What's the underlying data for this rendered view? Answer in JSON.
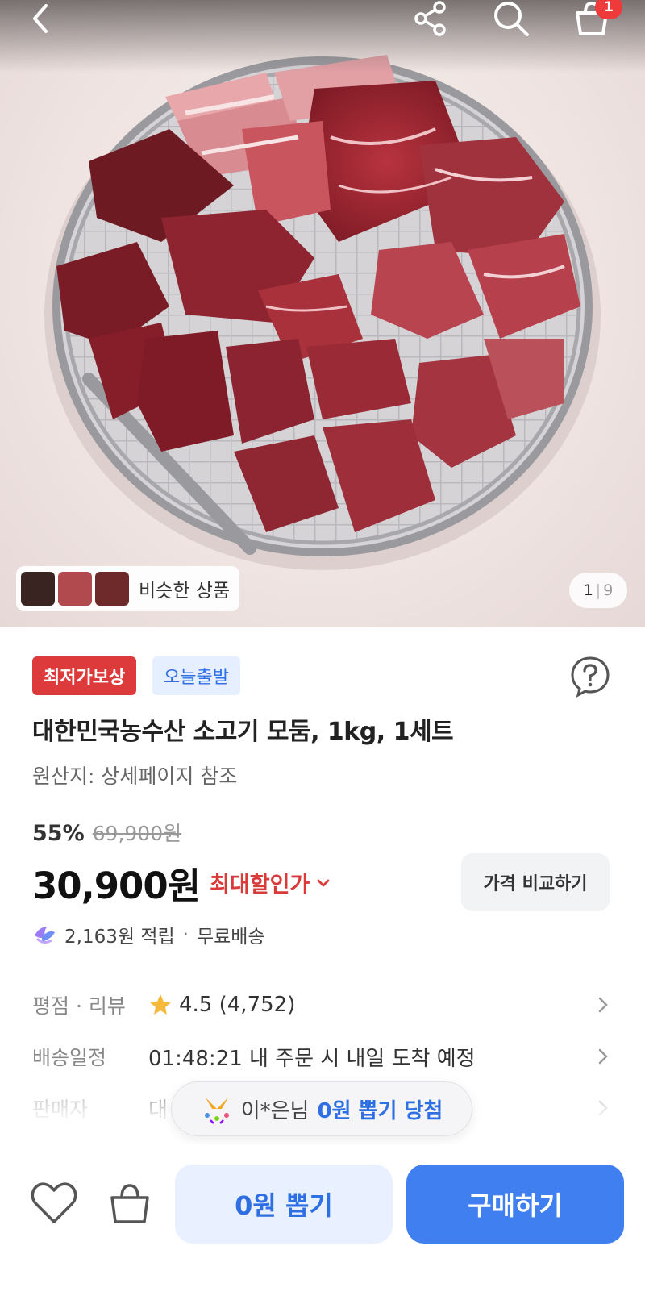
{
  "header": {
    "back_icon": "chevron-left-icon",
    "share_icon": "share-icon",
    "search_icon": "search-icon",
    "cart_icon": "cart-icon",
    "cart_badge": "1"
  },
  "gallery": {
    "similar_label": "비슷한 상품",
    "current": "1",
    "separator": "|",
    "total": "9"
  },
  "badges": {
    "lowest_price": "최저가보상",
    "today_ship": "오늘출발"
  },
  "product": {
    "title": "대한민국농수산 소고기 모둠, 1kg, 1세트",
    "origin": "원산지: 상세페이지 참조",
    "discount_rate": "55%",
    "original_price": "69,900원",
    "price": "30,900원",
    "max_discount_label": "최대할인가",
    "compare_button": "가격 비교하기",
    "points": "2,163원 적립",
    "shipping": "무료배송"
  },
  "info": {
    "rating_label": "평점 · 리뷰",
    "rating_value": "4.5 (4,752)",
    "delivery_label": "배송일정",
    "delivery_value": "01:48:21 내 주문 시 내일 도착 예정",
    "seller_label": "판매자",
    "seller_value": "대"
  },
  "toast": {
    "name": "이*은님",
    "message": "0원 뽑기 당첨"
  },
  "actions": {
    "zero_draw": "0원 뽑기",
    "buy": "구매하기"
  },
  "colors": {
    "accent_blue": "#3f7ff0",
    "accent_red": "#dd3a3c"
  }
}
